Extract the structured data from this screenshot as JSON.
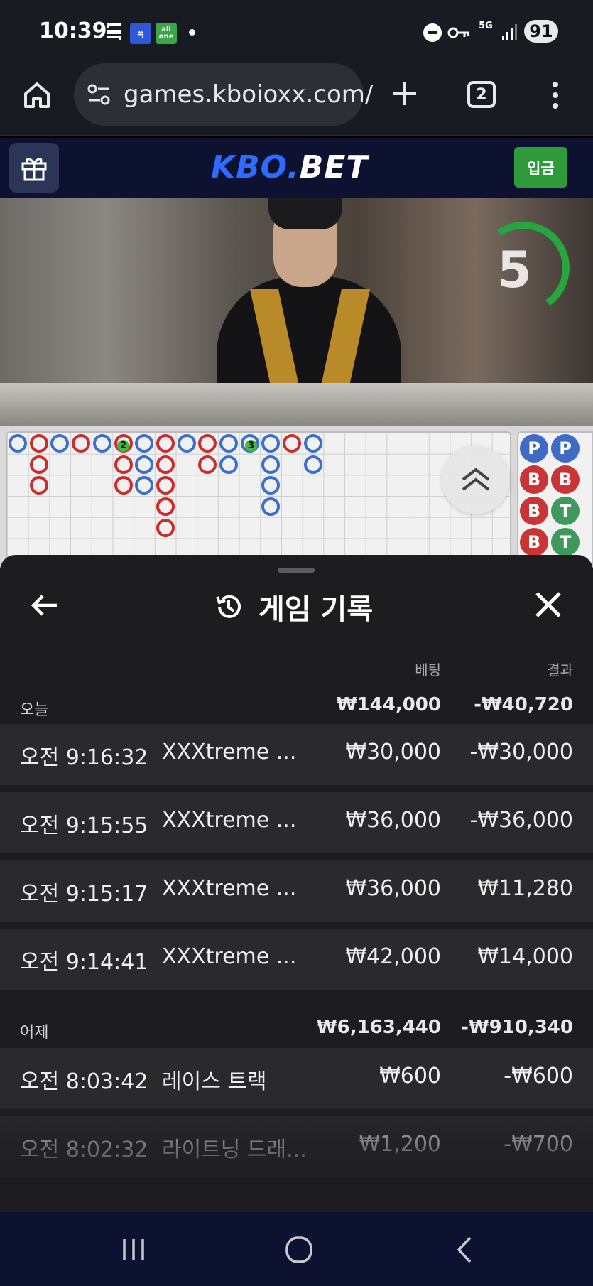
{
  "status_bar": {
    "time": "10:39",
    "app_badge_2": "쏙",
    "app_badge_3": "all one",
    "network": "5G",
    "battery": "91"
  },
  "browser": {
    "url": "games.kboioxx.com/",
    "tab_count": "2"
  },
  "site": {
    "logo_part1": "KBO.",
    "logo_part2": "BET",
    "deposit_label": "입금"
  },
  "video": {
    "countdown": "5"
  },
  "bead_road": {
    "badge_1": "2",
    "badge_2": "3",
    "side_pills": [
      {
        "label": "P",
        "type": "player"
      },
      {
        "label": "P",
        "type": "player"
      },
      {
        "label": "B",
        "type": "banker"
      },
      {
        "label": "B",
        "type": "banker"
      },
      {
        "label": "B",
        "type": "banker"
      },
      {
        "label": "T",
        "type": "tie"
      },
      {
        "label": "B",
        "type": "banker"
      },
      {
        "label": "T",
        "type": "tie"
      }
    ]
  },
  "history": {
    "title": "게임 기록",
    "col_bet": "베팅",
    "col_result": "결과",
    "sections": [
      {
        "label": "오늘",
        "bet_total": "₩144,000",
        "result_total": "-₩40,720",
        "rows": [
          {
            "time": "오전 9:16:32",
            "game": "XXXtreme ...",
            "bet": "₩30,000",
            "result": "-₩30,000"
          },
          {
            "time": "오전 9:15:55",
            "game": "XXXtreme ...",
            "bet": "₩36,000",
            "result": "-₩36,000"
          },
          {
            "time": "오전 9:15:17",
            "game": "XXXtreme ...",
            "bet": "₩36,000",
            "result": "₩11,280"
          },
          {
            "time": "오전 9:14:41",
            "game": "XXXtreme ...",
            "bet": "₩42,000",
            "result": "₩14,000"
          }
        ]
      },
      {
        "label": "어제",
        "bet_total": "₩6,163,440",
        "result_total": "-₩910,340",
        "rows": [
          {
            "time": "오전 8:03:42",
            "game": "레이스 트랙",
            "bet": "₩600",
            "result": "-₩600"
          },
          {
            "time": "오전 8:02:32",
            "game": "라이트닝 드래...",
            "bet": "₩1,200",
            "result": "-₩700"
          }
        ]
      }
    ]
  },
  "colors": {
    "header_bg": "#0c1230",
    "logo_accent": "#2e6bff",
    "deposit_green": "#2e9a3a",
    "sheet_bg": "#1d1d1f",
    "row_bg": "#2a2a2c",
    "banker_red": "#cc2c2c",
    "player_blue": "#3a6fd0"
  }
}
